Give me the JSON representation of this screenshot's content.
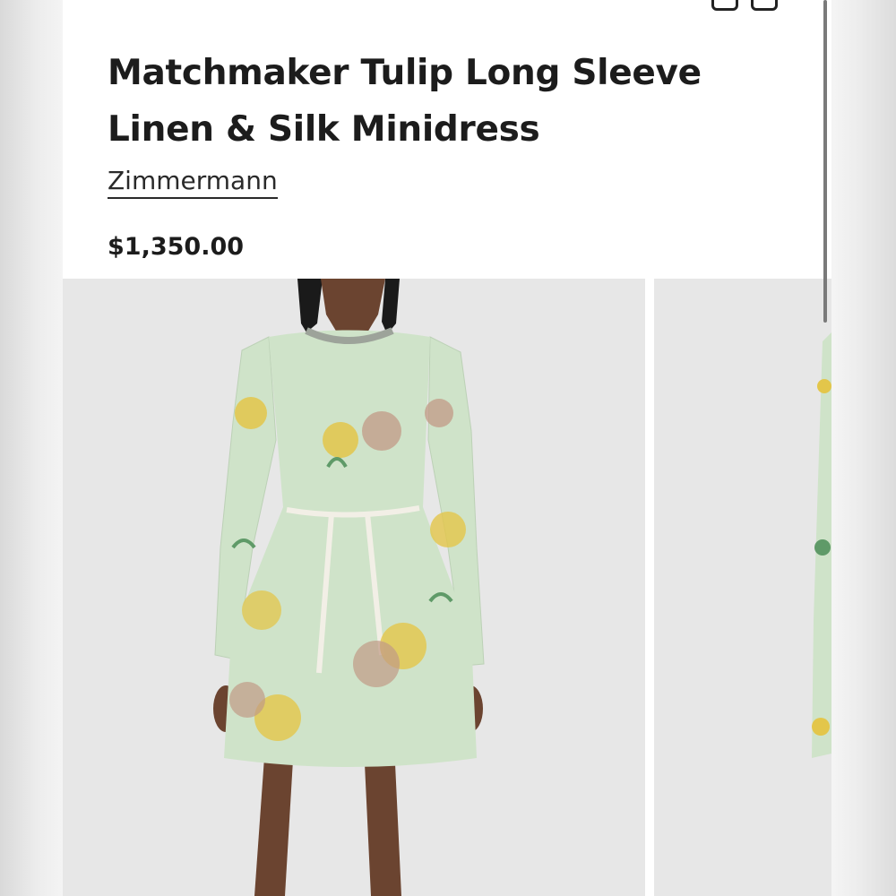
{
  "product": {
    "title": "Matchmaker Tulip Long Sleeve Linen & Silk Minidress",
    "brand": "Zimmermann",
    "price": "$1,350.00"
  },
  "gallery": {
    "images": [
      {
        "alt": "model wearing floral minidress, front view"
      },
      {
        "alt": "model wearing floral minidress, partial view"
      }
    ]
  },
  "colors": {
    "dress_base": "#cfe3c9",
    "print_yellow": "#e3c64a",
    "print_rose": "#c19a86",
    "print_leaf": "#5f9a68",
    "background": "#e7e7e7"
  }
}
